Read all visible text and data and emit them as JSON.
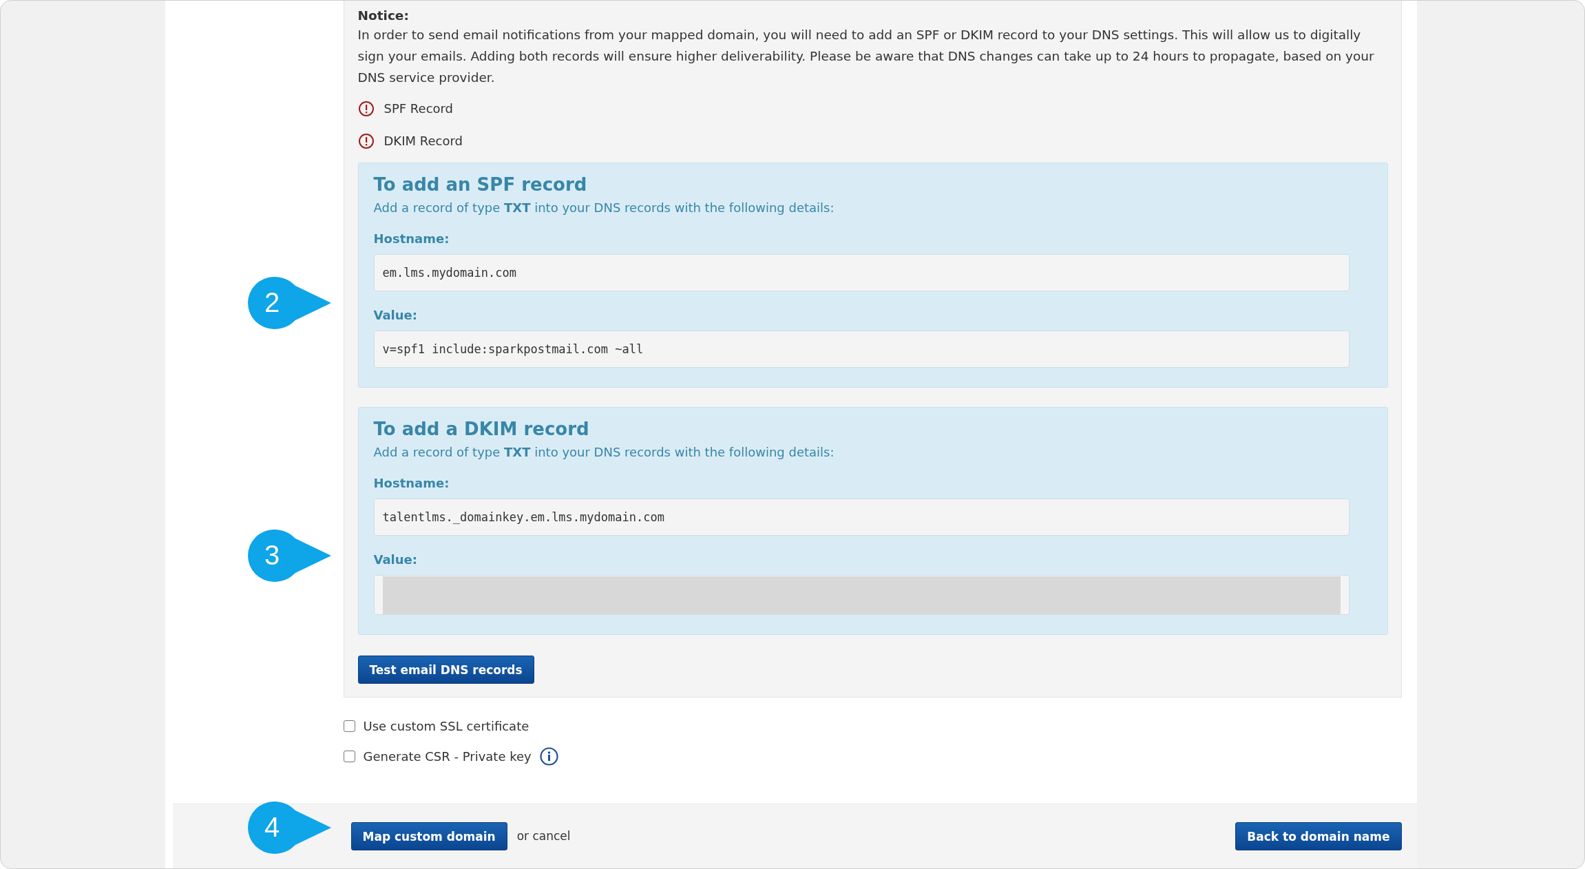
{
  "notice": {
    "title": "Notice:",
    "text": "In order to send email notifications from your mapped domain, you will need to add an SPF or DKIM record to your DNS settings. This will allow us to digitally sign your emails. Adding both records will ensure higher deliverability. Please be aware that DNS changes can take up to 24 hours to propagate, based on your DNS service provider."
  },
  "record_status": [
    {
      "label": "SPF Record",
      "kind": "warning"
    },
    {
      "label": "DKIM Record",
      "kind": "warning"
    }
  ],
  "record_boxes": [
    {
      "title": "To add an SPF record",
      "subtitle": "Add a record of type **TXT** into your DNS records with the following details:",
      "fields": [
        {
          "label": "Hostname:",
          "value": "em.lms.mydomain.com",
          "redacted": false
        },
        {
          "label": "Value:",
          "value": "v=spf1 include:sparkpostmail.com ~all",
          "redacted": false
        }
      ]
    },
    {
      "title": "To add a DKIM record",
      "subtitle": "Add a record of type **TXT** into your DNS records with the following details:",
      "fields": [
        {
          "label": "Hostname:",
          "value": "talentlms._domainkey.em.lms.mydomain.com",
          "redacted": false
        },
        {
          "label": "Value:",
          "redacted": true
        }
      ]
    }
  ],
  "test_button": "Test email DNS records",
  "options": [
    {
      "label": "Use custom SSL certificate",
      "checked": false,
      "info": false
    },
    {
      "label": "Generate CSR - Private key",
      "checked": false,
      "info": true
    }
  ],
  "footer": {
    "primary_button": "Map custom domain",
    "cancel_text": "or cancel",
    "back_button": "Back to domain name"
  },
  "callouts": [
    "2",
    "3",
    "4"
  ]
}
